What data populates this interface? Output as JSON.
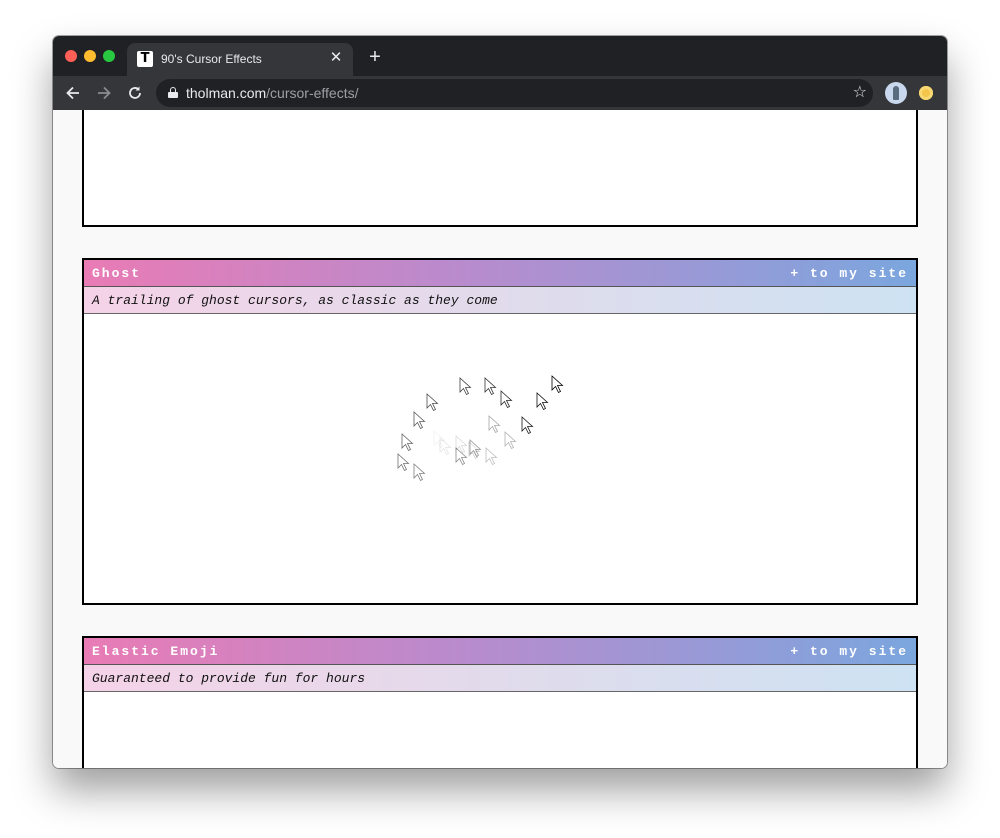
{
  "browser": {
    "tab_title": "90's Cursor Effects",
    "favicon_letter": "T",
    "close_glyph": "✕",
    "new_tab_glyph": "+",
    "url_host": "tholman.com",
    "url_path": "/cursor-effects/",
    "icons": {
      "back": "arrow-left-icon",
      "forward": "arrow-right-icon",
      "reload": "reload-icon",
      "lock": "lock-icon",
      "bookmark": "star-icon",
      "profile": "avatar",
      "extension": "extension-icon"
    }
  },
  "effects": [
    {
      "title": "Ghost",
      "action": "+ to my site",
      "description": "A trailing of ghost cursors, as classic as they come"
    },
    {
      "title": "Elastic Emoji",
      "action": "+ to my site",
      "description": "Guaranteed to provide fun for hours"
    }
  ],
  "colors": {
    "header_gradient": [
      "#e97bb5",
      "#b98bcd",
      "#7ba6de"
    ],
    "subheader_gradient": [
      "#f5d2e7",
      "#dfdcec",
      "#cde2f3"
    ],
    "chrome_dark": "#202124"
  },
  "ghost_trail_opacity": [
    0.05,
    0.1,
    0.15,
    0.2,
    0.25,
    0.3,
    0.35,
    0.4,
    0.45,
    0.5,
    0.55,
    0.6,
    0.65,
    0.7,
    0.75,
    0.8,
    0.85,
    0.9,
    0.95,
    1.0
  ]
}
